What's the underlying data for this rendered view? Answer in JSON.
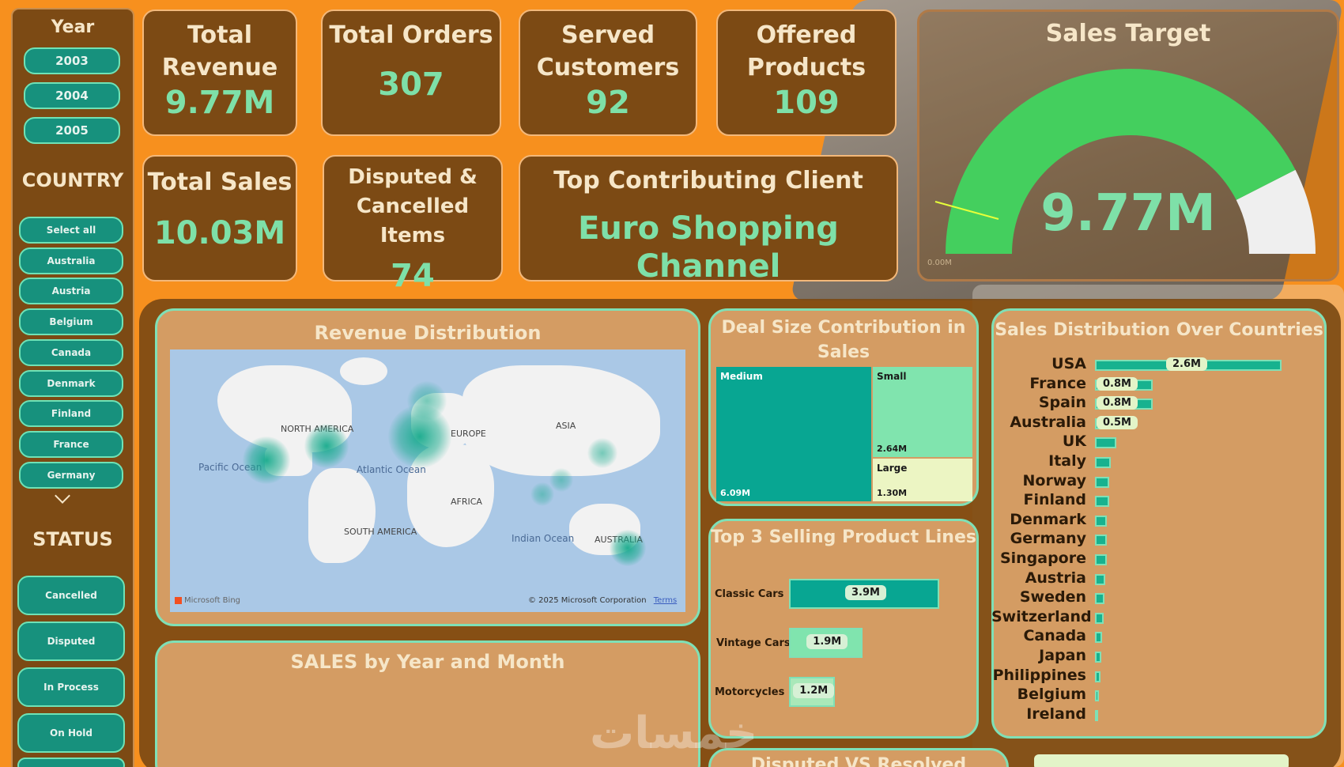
{
  "filters": {
    "year_title": "Year",
    "years": [
      "2003",
      "2004",
      "2005"
    ],
    "country_title": "COUNTRY",
    "countries": [
      "Select all",
      "Australia",
      "Austria",
      "Belgium",
      "Canada",
      "Denmark",
      "Finland",
      "France",
      "Germany"
    ],
    "status_title": "STATUS",
    "statuses": [
      "Cancelled",
      "Disputed",
      "In Process",
      "On Hold"
    ]
  },
  "kpis": {
    "total_revenue": {
      "label_1": "Total",
      "label_2": "Revenue",
      "value": "9.77M"
    },
    "total_orders": {
      "label": "Total Orders",
      "value": "307"
    },
    "served_customers": {
      "label_1": "Served",
      "label_2": "Customers",
      "value": "92"
    },
    "offered_products": {
      "label_1": "Offered",
      "label_2": "Products",
      "value": "109"
    },
    "total_sales": {
      "label": "Total Sales",
      "value": "10.03M"
    },
    "disputed": {
      "label_1": "Disputed &",
      "label_2": "Cancelled Items",
      "value": "74"
    },
    "top_client": {
      "label": "Top Contributing Client",
      "value": "Euro Shopping Channel"
    }
  },
  "gauge": {
    "title": "Sales Target",
    "value": "9.77M",
    "fraction": 0.85,
    "min_label": "0.00M",
    "color_fill": "#44cf5e",
    "color_rest": "#efefef"
  },
  "revenue_map": {
    "title": "Revenue Distribution",
    "continents": [
      "NORTH AMERICA",
      "EUROPE",
      "ASIA",
      "AFRICA",
      "SOUTH AMERICA",
      "AUSTRALIA"
    ],
    "oceans": [
      "Pacific Ocean",
      "Atlantic Ocean",
      "Indian Ocean"
    ],
    "attribution": "© 2025 Microsoft Corporation",
    "terms": "Terms",
    "bing": "Microsoft Bing"
  },
  "sales_by_month": {
    "title": "SALES by Year and Month"
  },
  "deal_size": {
    "title_1": "Deal Size Contribution in",
    "title_2": "Sales",
    "segments": [
      {
        "name": "Medium",
        "value": "6.09M"
      },
      {
        "name": "Small",
        "value": "2.64M"
      },
      {
        "name": "Large",
        "value": "1.30M"
      }
    ]
  },
  "top_products": {
    "title": "Top 3 Selling Product Lines",
    "items": [
      {
        "name": "Classic Cars",
        "value": "3.9M",
        "amount": 3.9
      },
      {
        "name": "Vintage Cars",
        "value": "1.9M",
        "amount": 1.9
      },
      {
        "name": "Motorcycles",
        "value": "1.2M",
        "amount": 1.2
      }
    ]
  },
  "countries_chart": {
    "title": "Sales Distribution Over Countries",
    "items": [
      {
        "name": "USA",
        "value": "2.6M",
        "amount": 2.6
      },
      {
        "name": "France",
        "value": "0.8M",
        "amount": 0.8
      },
      {
        "name": "Spain",
        "value": "0.8M",
        "amount": 0.8
      },
      {
        "name": "Australia",
        "value": "0.5M",
        "amount": 0.5
      },
      {
        "name": "UK",
        "value": "",
        "amount": 0.3
      },
      {
        "name": "Italy",
        "value": "",
        "amount": 0.22
      },
      {
        "name": "Norway",
        "value": "",
        "amount": 0.2
      },
      {
        "name": "Finland",
        "value": "",
        "amount": 0.2
      },
      {
        "name": "Denmark",
        "value": "",
        "amount": 0.16
      },
      {
        "name": "Germany",
        "value": "",
        "amount": 0.16
      },
      {
        "name": "Singapore",
        "value": "",
        "amount": 0.16
      },
      {
        "name": "Austria",
        "value": "",
        "amount": 0.14
      },
      {
        "name": "Sweden",
        "value": "",
        "amount": 0.13
      },
      {
        "name": "Switzerland",
        "value": "",
        "amount": 0.12
      },
      {
        "name": "Canada",
        "value": "",
        "amount": 0.1
      },
      {
        "name": "Japan",
        "value": "",
        "amount": 0.09
      },
      {
        "name": "Philippines",
        "value": "",
        "amount": 0.08
      },
      {
        "name": "Belgium",
        "value": "",
        "amount": 0.05
      },
      {
        "name": "Ireland",
        "value": "",
        "amount": 0.04
      }
    ]
  },
  "bottom": {
    "disputed_vs_resolved": "Disputed VS Resolved"
  },
  "watermark": "خمسات"
}
